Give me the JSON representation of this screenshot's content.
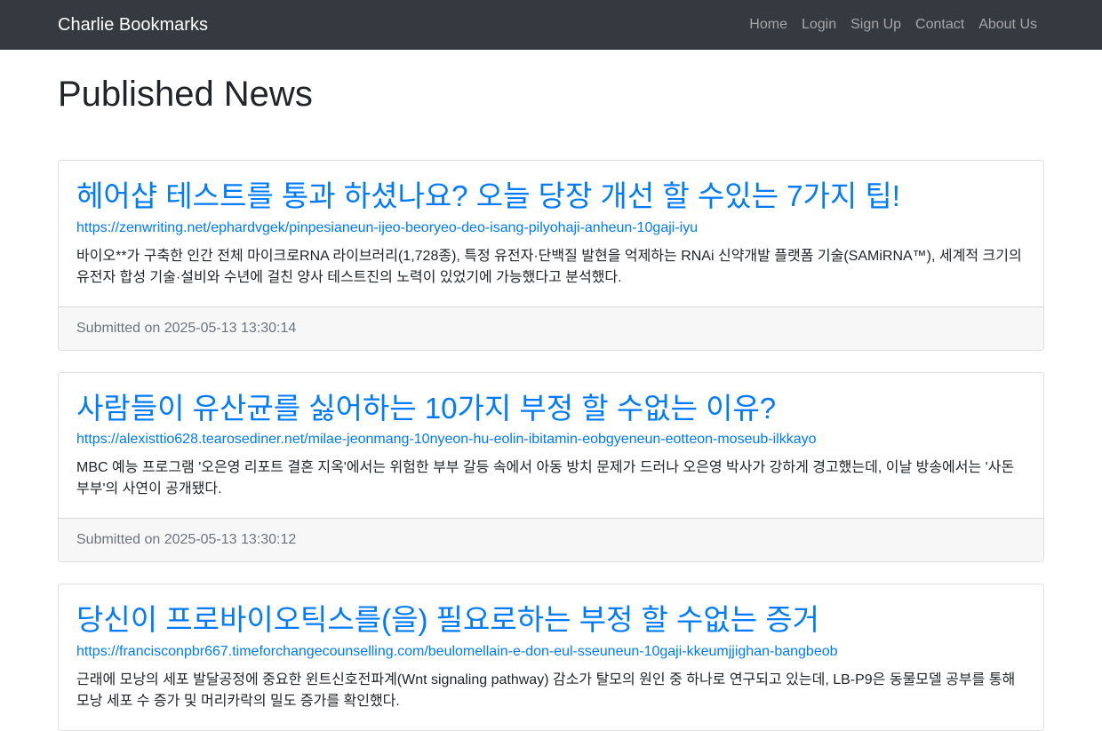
{
  "navbar": {
    "brand": "Charlie Bookmarks",
    "links": [
      "Home",
      "Login",
      "Sign Up",
      "Contact",
      "About Us"
    ],
    "background": "#343a40"
  },
  "page": {
    "title": "Published News"
  },
  "posts": [
    {
      "title": "헤어샵 테스트를 통과 하셨나요? 오늘 당장 개선 할 수있는 7가지 팁!",
      "url": "https://zenwriting.net/ephardvgek/pinpesianeun-ijeo-beoryeo-deo-isang-pilyohaji-anheun-10gaji-iyu",
      "text": "바이오**가 구축한 인간 전체 마이크로RNA 라이브러리(1,728종), 특정 유전자·단백질 발현을 억제하는 RNAi 신약개발 플랫폼 기술(SAMiRNA™), 세계적 크기의 유전자 합성 기술·설비와 수년에 걸친 양사 테스트진의 노력이 있었기에 가능했다고 분석했다.",
      "submitted": "Submitted on 2025-05-13 13:30:14"
    },
    {
      "title": "사람들이 유산균를 싫어하는 10가지 부정 할 수없는 이유?",
      "url": "https://alexisttio628.tearosediner.net/milae-jeonmang-10nyeon-hu-eolin-ibitamin-eobgyeneun-eotteon-moseub-ilkkayo",
      "text": "MBC 예능 프로그램 '오은영 리포트 결혼 지옥'에서는 위험한 부부 갈등 속에서 아동 방치 문제가 드러나 오은영 박사가 강하게 경고했는데, 이날 방송에서는 '사돈부부'의 사연이 공개됐다.",
      "submitted": "Submitted on 2025-05-13 13:30:12"
    },
    {
      "title": "당신이 프로바이오틱스를(을) 필요로하는 부정 할 수없는 증거",
      "url": "https://francisconpbr667.timeforchangecounselling.com/beulomellain-e-don-eul-sseuneun-10gaji-kkeumjjighan-bangbeob",
      "text": "근래에 모낭의 세포 발달공정에 중요한 윈트신호전파계(Wnt signaling pathway) 감소가 탈모의 원인 중 하나로 연구되고 있는데, LB-P9은 동물모델 공부를 통해 모낭 세포 수 증가 및 머리카락의 밀도 증가를 확인했다.",
      "submitted": ""
    }
  ],
  "colors": {
    "link": "#007bff",
    "muted": "#6c757d",
    "text": "#212529"
  }
}
